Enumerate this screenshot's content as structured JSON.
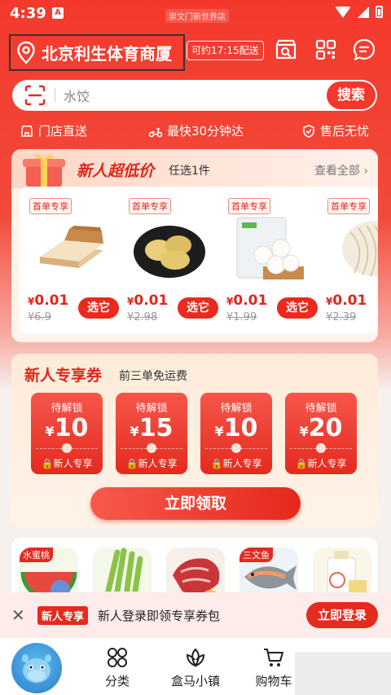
{
  "status_bar": {
    "time": "4:39",
    "notification_label": "A",
    "carrier_pill": "崇文门新世界店"
  },
  "header": {
    "location": "北京利生体育商厦",
    "delivery": "可约17:15配送",
    "icons": [
      "store-search-icon",
      "qr-code-icon",
      "message-icon"
    ]
  },
  "search": {
    "placeholder": "水饺",
    "button": "搜索"
  },
  "promises": [
    {
      "icon": "store-icon",
      "label": "门店直送"
    },
    {
      "icon": "scooter-icon",
      "label": "最快30分钟达"
    },
    {
      "icon": "shield-icon",
      "label": "售后无忧"
    }
  ],
  "new_user_deals": {
    "title": "新人超低价",
    "subtitle": "任选1件",
    "more": "查看全部",
    "products": [
      {
        "tag": "首单专享",
        "price_symbol": "¥",
        "price": "0.01",
        "original": "¥6.9",
        "button": "选它",
        "image": "bread-slices"
      },
      {
        "tag": "首单专享",
        "price_symbol": "¥",
        "price": "0.01",
        "original": "¥2.98",
        "button": "选它",
        "image": "potatoes"
      },
      {
        "tag": "首单专享",
        "price_symbol": "¥",
        "price": "0.01",
        "original": "¥1.99",
        "button": "选它",
        "image": "steamed-buns"
      },
      {
        "tag": "首单专享",
        "price_symbol": "¥",
        "price": "0.01",
        "original": "¥2.39",
        "button": "选它",
        "image": "noodles"
      }
    ]
  },
  "coupons": {
    "title": "新人专享券",
    "subtitle": "前三单免运费",
    "items": [
      {
        "status": "待解锁",
        "symbol": "¥",
        "amount": "10",
        "footer": "新人专享"
      },
      {
        "status": "待解锁",
        "symbol": "¥",
        "amount": "15",
        "footer": "新人专享"
      },
      {
        "status": "待解锁",
        "symbol": "¥",
        "amount": "10",
        "footer": "新人专享"
      },
      {
        "status": "待解锁",
        "symbol": "¥",
        "amount": "20",
        "footer": "新人专享"
      }
    ],
    "claim_button": "立即领取"
  },
  "categories": [
    {
      "tag": "水蜜桃",
      "image": "watermelon"
    },
    {
      "tag": "",
      "image": "green-onion"
    },
    {
      "tag": "",
      "image": "meat"
    },
    {
      "tag": "三文鱼",
      "image": "fish"
    },
    {
      "tag": "",
      "image": "milk"
    }
  ],
  "login_banner": {
    "close": "✕",
    "tag": "新人专享",
    "text": "新人登录即领专享券包",
    "button": "立即登录"
  },
  "tabbar": {
    "items": [
      {
        "label": "分类",
        "icon": "category-icon"
      },
      {
        "label": "盒马小镇",
        "icon": "lotus-icon"
      },
      {
        "label": "购物车",
        "icon": "cart-icon"
      }
    ]
  },
  "colors": {
    "brand_red": "#f4392c",
    "accent_red": "#e52a1e",
    "coupon_bg": "#fdebd9"
  }
}
